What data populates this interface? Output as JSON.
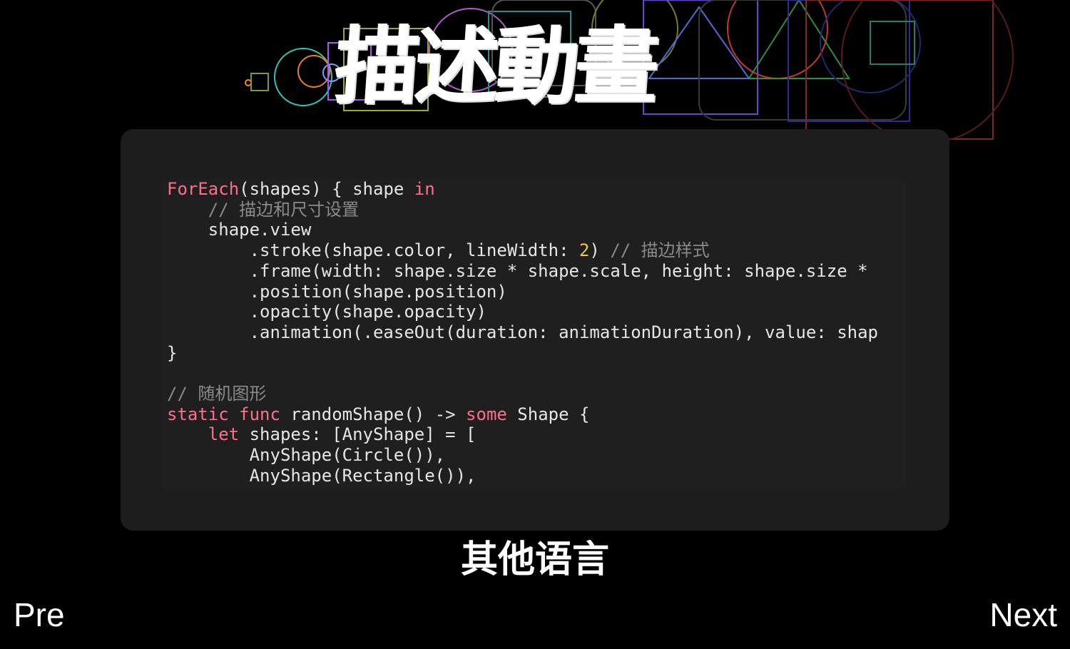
{
  "header": {
    "title": "描述動畫"
  },
  "code": {
    "lines": [
      {
        "indent": "",
        "parts": [
          {
            "t": "kw",
            "s": "ForEach"
          },
          {
            "t": "tx",
            "s": "(shapes) { shape "
          },
          {
            "t": "kw",
            "s": "in"
          }
        ]
      },
      {
        "indent": "    ",
        "parts": [
          {
            "t": "cm",
            "s": "// 描边和尺寸设置"
          }
        ]
      },
      {
        "indent": "    ",
        "parts": [
          {
            "t": "tx",
            "s": "shape.view"
          }
        ]
      },
      {
        "indent": "        ",
        "parts": [
          {
            "t": "tx",
            "s": ".stroke(shape.color, lineWidth: "
          },
          {
            "t": "num",
            "s": "2"
          },
          {
            "t": "tx",
            "s": ") "
          },
          {
            "t": "cm",
            "s": "// 描边样式"
          }
        ]
      },
      {
        "indent": "        ",
        "parts": [
          {
            "t": "tx",
            "s": ".frame(width: shape.size * shape.scale, height: shape.size *"
          }
        ]
      },
      {
        "indent": "        ",
        "parts": [
          {
            "t": "tx",
            "s": ".position(shape.position)"
          }
        ]
      },
      {
        "indent": "        ",
        "parts": [
          {
            "t": "tx",
            "s": ".opacity(shape.opacity)"
          }
        ]
      },
      {
        "indent": "        ",
        "parts": [
          {
            "t": "tx",
            "s": ".animation(.easeOut(duration: animationDuration), value: shap"
          }
        ]
      },
      {
        "indent": "",
        "parts": [
          {
            "t": "tx",
            "s": "}"
          }
        ]
      },
      {
        "indent": "",
        "parts": [
          {
            "t": "tx",
            "s": ""
          }
        ]
      },
      {
        "indent": "",
        "parts": [
          {
            "t": "cm",
            "s": "// 随机图形"
          }
        ]
      },
      {
        "indent": "",
        "parts": [
          {
            "t": "kw",
            "s": "static"
          },
          {
            "t": "tx",
            "s": " "
          },
          {
            "t": "kw",
            "s": "func"
          },
          {
            "t": "tx",
            "s": " randomShape() -> "
          },
          {
            "t": "kw",
            "s": "some"
          },
          {
            "t": "tx",
            "s": " Shape {"
          }
        ]
      },
      {
        "indent": "    ",
        "parts": [
          {
            "t": "kw",
            "s": "let"
          },
          {
            "t": "tx",
            "s": " shapes: [AnyShape] = ["
          }
        ]
      },
      {
        "indent": "        ",
        "parts": [
          {
            "t": "tx",
            "s": "AnyShape(Circle()),"
          }
        ]
      },
      {
        "indent": "        ",
        "parts": [
          {
            "t": "tx",
            "s": "AnyShape(Rectangle()),"
          }
        ]
      }
    ],
    "colors": {
      "keyword": "#ff6f8a",
      "number": "#f5c842",
      "comment": "#8a8a8a",
      "text": "#e6e6e6"
    }
  },
  "subtitle": "其他语言",
  "nav": {
    "prev_label": "Pre",
    "next_label": "Next"
  }
}
